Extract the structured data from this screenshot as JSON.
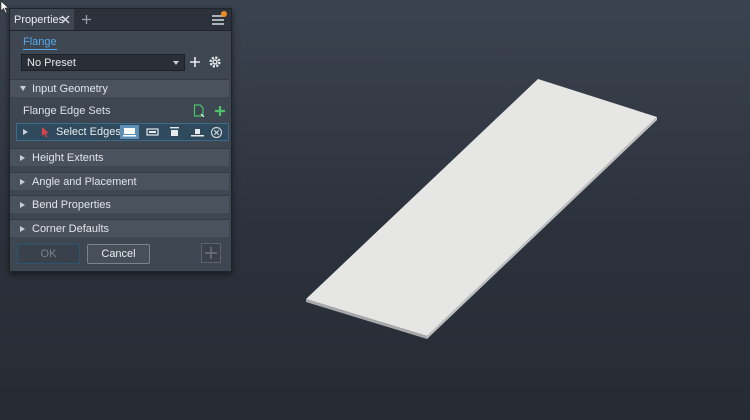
{
  "panel": {
    "tab_label": "Properties",
    "feature_title": "Flange",
    "preset_value": "No Preset",
    "sections": {
      "input_geometry": "Input Geometry",
      "height_extents": "Height Extents",
      "angle_placement": "Angle and Placement",
      "bend_properties": "Bend Properties",
      "corner_defaults": "Corner Defaults"
    },
    "flange_edge_sets": "Flange Edge Sets",
    "select_edges": "Select Edges",
    "ok_label": "OK",
    "cancel_label": "Cancel"
  },
  "colors": {
    "accent": "#56a8e8",
    "notification": "#f08a24",
    "add_green": "#4cc36b",
    "select_red": "#e0444b",
    "part_face": "#e6e6e4"
  },
  "icons": [
    "close-icon",
    "plus-icon",
    "hamburger-menu-icon",
    "gear-icon",
    "document-icon",
    "cursor-arrow-icon",
    "clear-icon"
  ]
}
